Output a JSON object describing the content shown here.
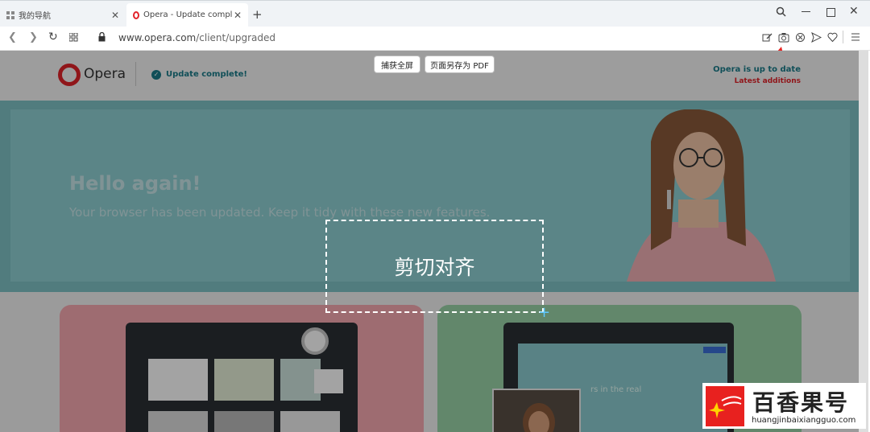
{
  "tabs": [
    {
      "label": "我的导航"
    },
    {
      "label": "Opera - Update complete!"
    }
  ],
  "toolbar": {
    "url_host": "www.opera.com",
    "url_path": "/client/upgraded"
  },
  "page": {
    "brand": "Opera",
    "update_status": "Update complete!",
    "up_to_date": "Opera is up to date",
    "latest_additions": "Latest additions",
    "hero_title": "Hello again!",
    "hero_subtitle": "Your browser has been updated. Keep it tidy with these new features.",
    "card_green_caption": "rs in the real"
  },
  "capture": {
    "fullscreen_label": "捕获全屏",
    "save_pdf_label": "页面另存为 PDF",
    "selection_label": "剪切对齐"
  },
  "watermark": {
    "title": "百香果号",
    "url": "huangjinbaixiangguo.com"
  },
  "colors": {
    "opera_red": "#e2232a",
    "hero_teal": "#8fd0d4",
    "pink_card": "#f7a9b1",
    "green_card": "#9ad4a8"
  }
}
